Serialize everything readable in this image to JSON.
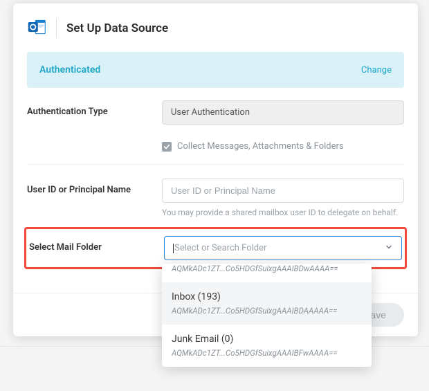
{
  "header": {
    "title": "Set Up Data Source"
  },
  "auth_banner": {
    "status": "Authenticated",
    "change_label": "Change"
  },
  "auth_type": {
    "label": "Authentication Type",
    "value": "User Authentication"
  },
  "collect_checkbox": {
    "label": "Collect Messages, Attachments & Folders",
    "checked": true
  },
  "user_id": {
    "label": "User ID or Principal Name",
    "placeholder": "User ID or Principal Name",
    "hint": "You may provide a shared mailbox user ID to delegate on behalf."
  },
  "mail_folder": {
    "label": "Select Mail Folder",
    "placeholder": "Select or Search Folder"
  },
  "dropdown": {
    "items": [
      {
        "label": "",
        "id": "AQMkADc1ZT...Co5HDGfSuixgAAAIBDwAAAA=="
      },
      {
        "label": "Inbox (193)",
        "id": "AQMkADc1ZT...Co5HDGfSuixgAAAIBDAAAAA=="
      },
      {
        "label": "Junk Email (0)",
        "id": "AQMkADc1ZT...Co5HDGfSuixgAAAIBFwAAAA=="
      }
    ]
  },
  "footer": {
    "save_label": "Save"
  }
}
